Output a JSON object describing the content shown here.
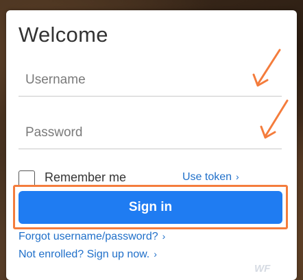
{
  "login": {
    "title": "Welcome",
    "username_placeholder": "Username",
    "password_placeholder": "Password",
    "remember_label": "Remember me",
    "use_token_label": "Use token",
    "sign_in_label": "Sign in",
    "forgot_link": "Forgot username/password?",
    "enroll_link": "Not enrolled? Sign up now."
  },
  "icons": {
    "chevron": "›",
    "annotation_arrows": [
      "arrow-to-username",
      "arrow-to-password"
    ]
  },
  "colors": {
    "primary_button": "#1f7cf2",
    "link": "#1f6fc9",
    "annotation": "#f47c3c"
  },
  "watermark": "WF"
}
